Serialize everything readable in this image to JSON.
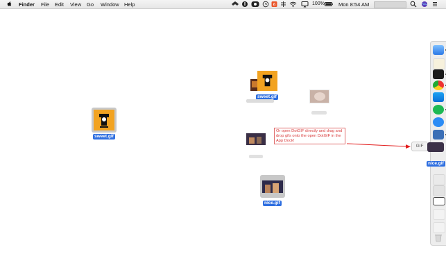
{
  "menubar": {
    "app_name": "Finder",
    "menus": [
      "File",
      "Edit",
      "View",
      "Go",
      "Window",
      "Help"
    ],
    "battery": "100%",
    "clock": "Mon 8:54 AM"
  },
  "desktop": {
    "sweet_gif_left": "sweet.gif",
    "sweet_gif_cluster": "sweet.gif",
    "nice_gif_center": "nice.gif",
    "nice_gif_drag": "nice.gif"
  },
  "callout": {
    "text": "Or open DotGIF directly and drag and drop gifs onto the open DotGIF in the App Dock!"
  },
  "gif_button": {
    "label": "GIF"
  },
  "colors": {
    "accent": "#2f6fe0",
    "arrow": "#e21b1b"
  },
  "icons": {
    "apple": "apple-icon",
    "search": "search-icon",
    "wifi": "wifi-icon",
    "airplay": "airplay-icon"
  }
}
